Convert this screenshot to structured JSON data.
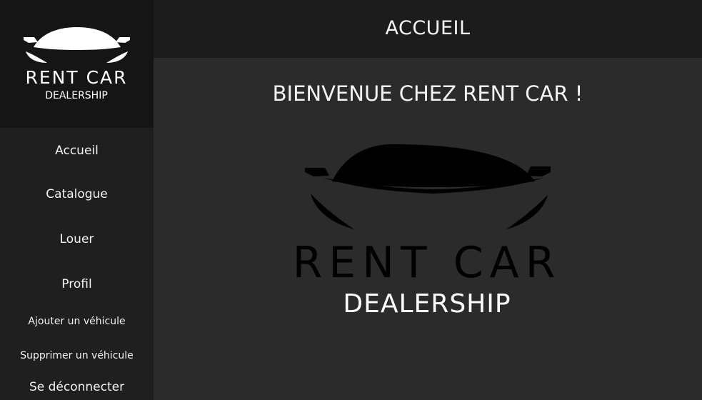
{
  "header": {
    "title": "ACCUEIL"
  },
  "sidebar": {
    "logo": {
      "line1": "RENT CAR",
      "line2": "DEALERSHIP"
    },
    "items": [
      {
        "label": "Accueil"
      },
      {
        "label": "Catalogue"
      },
      {
        "label": "Louer"
      },
      {
        "label": "Profil"
      },
      {
        "label": "Ajouter un véhicule"
      },
      {
        "label": "Supprimer un véhicule"
      },
      {
        "label": "Se déconnecter"
      }
    ]
  },
  "main": {
    "welcome": "BIENVENUE CHEZ RENT CAR !",
    "hero_logo": {
      "line1": "RENT CAR",
      "line2": "DEALERSHIP"
    }
  },
  "colors": {
    "sidebar_bg": "#1f1f1f",
    "logo_bg": "#151515",
    "header_bg": "#1c1c1c",
    "main_bg": "#2b2b2b",
    "text": "#f2f2f2",
    "hero_car": "#000000"
  }
}
